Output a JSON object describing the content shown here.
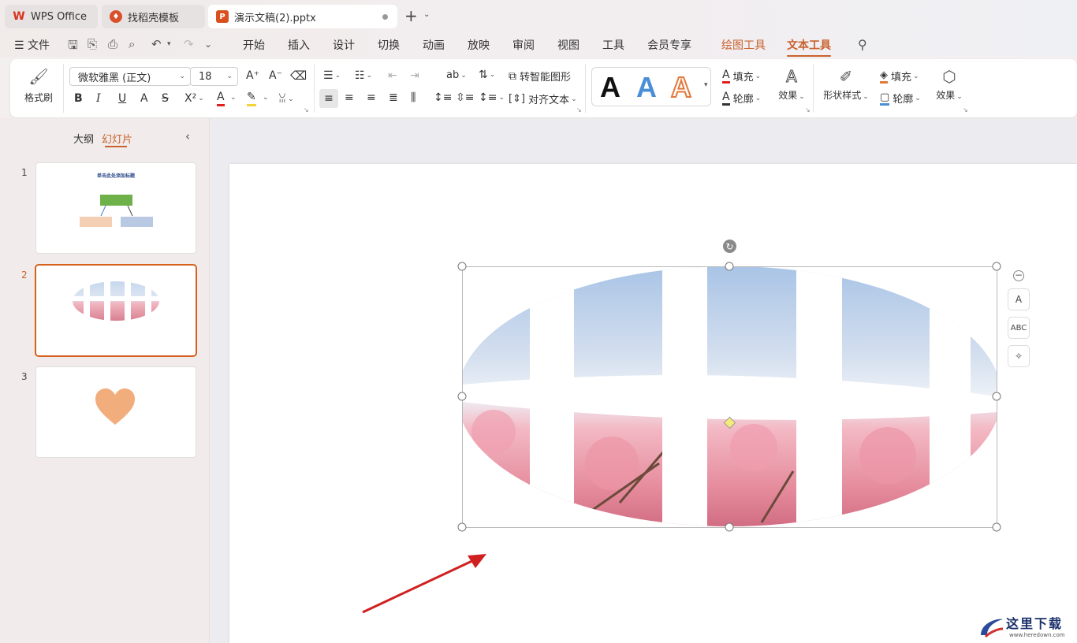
{
  "tabs": [
    {
      "label": "WPS Office",
      "icon": "wps-logo-icon",
      "color": "#d9321f"
    },
    {
      "label": "找稻壳模板",
      "icon": "docer-icon",
      "color": "#d9502a"
    },
    {
      "label": "演示文稿(2).pptx",
      "icon": "presentation-icon",
      "color": "#d9501f"
    }
  ],
  "menu": {
    "file": "文件",
    "items": [
      "开始",
      "插入",
      "设计",
      "切换",
      "动画",
      "放映",
      "审阅",
      "视图",
      "工具",
      "会员专享"
    ],
    "context": [
      "绘图工具",
      "文本工具"
    ],
    "active": "文本工具"
  },
  "ribbon": {
    "format_painter": "格式刷",
    "font_name": "微软雅黑 (正文)",
    "font_size": "18",
    "smart_graphic": "转智能图形",
    "align_text": "对齐文本",
    "text_fill": "填充",
    "text_outline": "轮廓",
    "text_effect": "效果",
    "shape_style": "形状样式",
    "shape_fill": "填充",
    "shape_outline": "轮廓",
    "shape_effect": "效果",
    "accent_orange": "#c9622e"
  },
  "panel": {
    "tab_outline": "大纲",
    "tab_slides": "幻灯片",
    "slides": [
      {
        "num": "1",
        "title": "单击此处添加标题"
      },
      {
        "num": "2"
      },
      {
        "num": "3"
      }
    ],
    "selected": "2"
  },
  "watermark": {
    "cn": "这里下载",
    "url": "www.heredown.com"
  }
}
